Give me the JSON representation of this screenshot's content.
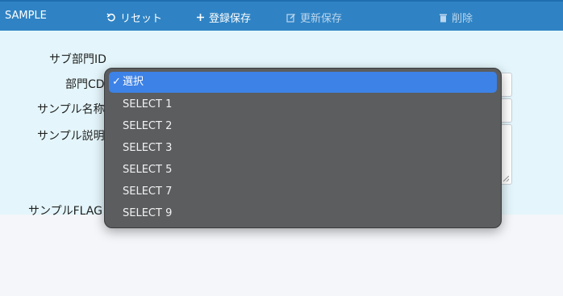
{
  "toolbar": {
    "brand": "SAMPLE",
    "reset_label": "リセット",
    "save_label": "登録保存",
    "update_label": "更新保存",
    "delete_label": "削除"
  },
  "form": {
    "labels": {
      "sub_dept_id": "サブ部門ID",
      "dept_cd": "部門CD",
      "sample_name": "サンプル名称",
      "sample_desc": "サンプル説明",
      "sample_flag": "サンプルFLAG"
    }
  },
  "dropdown": {
    "options": [
      {
        "label": "選択",
        "selected": true
      },
      {
        "label": "SELECT 1",
        "selected": false
      },
      {
        "label": "SELECT 2",
        "selected": false
      },
      {
        "label": "SELECT 3",
        "selected": false
      },
      {
        "label": "SELECT 5",
        "selected": false
      },
      {
        "label": "SELECT 7",
        "selected": false
      },
      {
        "label": "SELECT 9",
        "selected": false
      }
    ],
    "check_mark": "✓"
  },
  "colors": {
    "toolbar": "#2f83c4",
    "content_bg": "#e4f6fb",
    "dropdown_bg": "#5b5d5f",
    "selected_bg": "#3d82e6"
  }
}
